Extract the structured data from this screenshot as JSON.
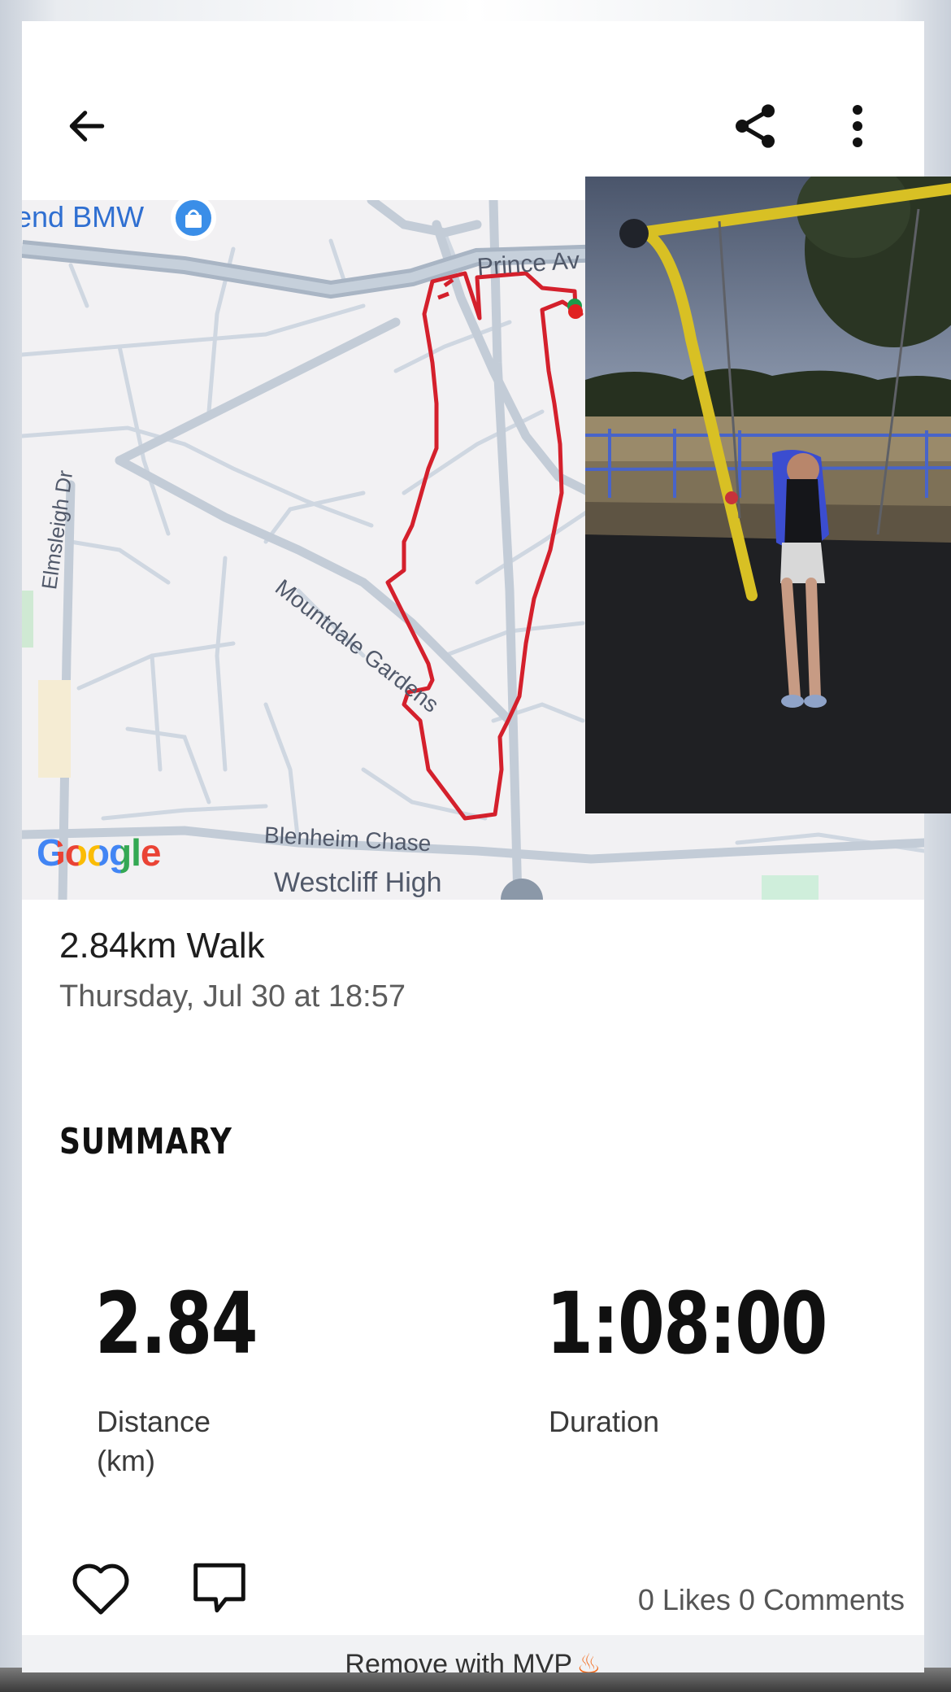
{
  "header": {
    "back_icon": "arrow-left-icon",
    "share_icon": "share-icon",
    "menu_icon": "more-vertical-icon"
  },
  "map": {
    "label_dealer": "end BMW",
    "label_prince": "Prince Av",
    "label_elmsleigh": "Elmsleigh Dr",
    "label_mountdale": "Mountdale Gardens",
    "label_blenheim": "Blenheim Chase",
    "label_westcliff": "Westcliff High",
    "google_logo": "Google",
    "route_color": "#d4202c",
    "road_color": "#c9d2dd"
  },
  "activity": {
    "title": "2.84km Walk",
    "date": "Thursday, Jul 30 at 18:57"
  },
  "summary": {
    "heading": "SUMMARY",
    "distance_value": "2.84",
    "distance_label": "Distance\n(km)",
    "duration_value": "1:08:00",
    "duration_label": "Duration"
  },
  "social": {
    "like_icon": "heart-icon",
    "comment_icon": "comment-icon",
    "counts": "0 Likes 0 Comments"
  },
  "footer": {
    "ad_text": "Remove with MVP",
    "ad_icon": "flame-icon",
    "ad_color": "#f26a1b"
  }
}
